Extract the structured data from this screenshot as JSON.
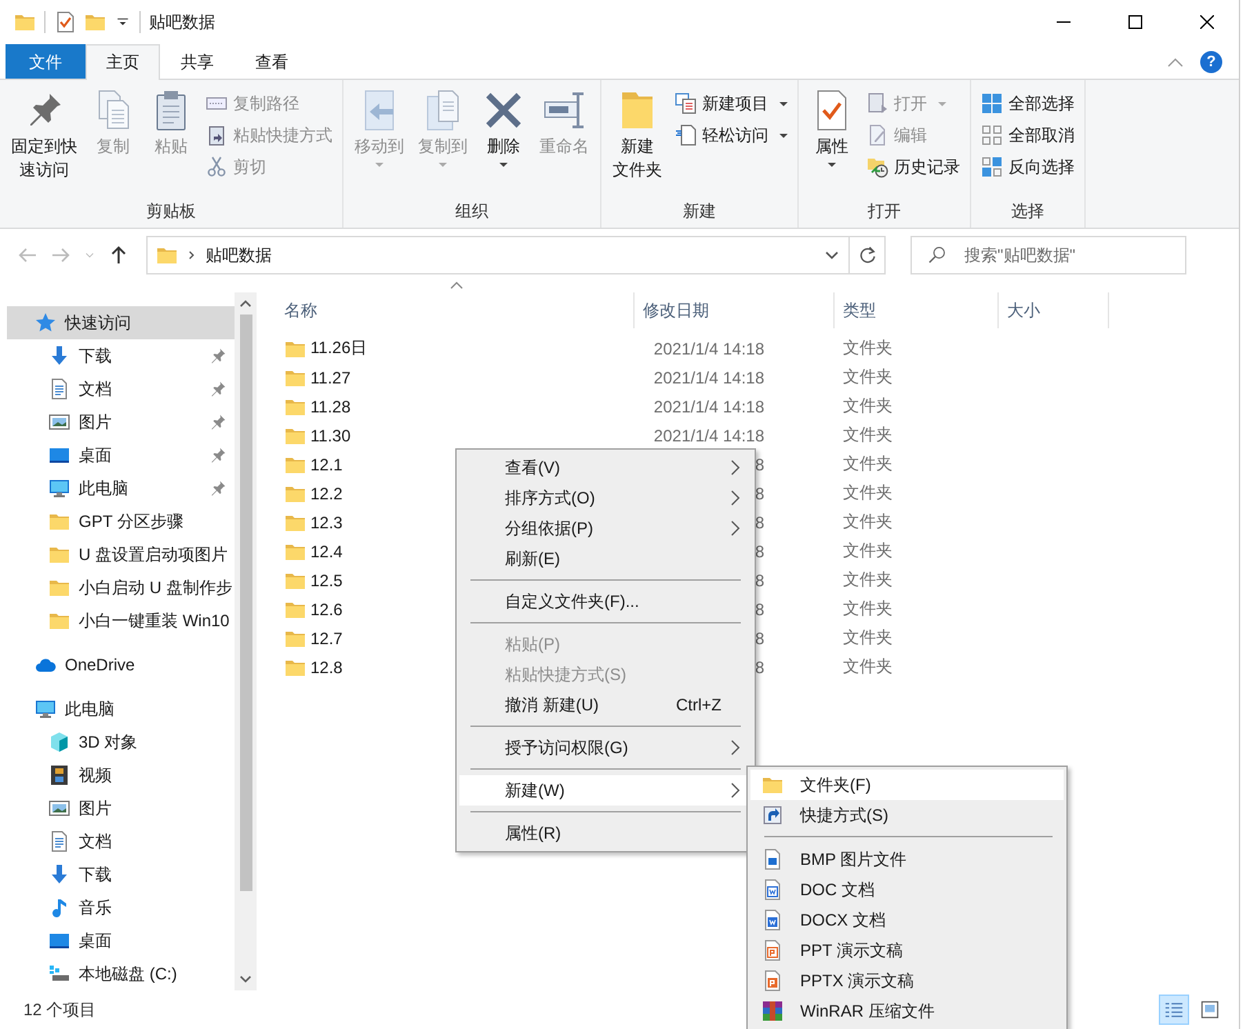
{
  "window": {
    "title": "贴吧数据"
  },
  "ribbon_tabs": [
    {
      "label": "文件",
      "kind": "file",
      "selected": false
    },
    {
      "label": "主页",
      "kind": "tab",
      "selected": true
    },
    {
      "label": "共享",
      "kind": "tab",
      "selected": false
    },
    {
      "label": "查看",
      "kind": "tab",
      "selected": false
    }
  ],
  "help_button": {
    "label": "?"
  },
  "ribbon_groups": [
    {
      "label": "剪贴板",
      "commands": [
        {
          "label": [
            "固定到快",
            "速访问"
          ],
          "kind": "large",
          "disabled": false,
          "dropdown": false
        },
        {
          "label": [
            "复制"
          ],
          "kind": "large",
          "disabled": true,
          "dropdown": false
        },
        {
          "label": [
            "粘贴"
          ],
          "kind": "large",
          "disabled": true,
          "dropdown": false
        },
        {
          "label": "复制路径",
          "kind": "small",
          "disabled": true,
          "dropdown": false
        },
        {
          "label": "粘贴快捷方式",
          "kind": "small",
          "disabled": true,
          "dropdown": false
        },
        {
          "label": "剪切",
          "kind": "small",
          "disabled": true,
          "dropdown": false
        }
      ]
    },
    {
      "label": "组织",
      "commands": [
        {
          "label": [
            "移动到"
          ],
          "kind": "large",
          "disabled": true,
          "dropdown": true
        },
        {
          "label": [
            "复制到"
          ],
          "kind": "large",
          "disabled": true,
          "dropdown": true
        },
        {
          "label": [
            "删除"
          ],
          "kind": "large",
          "disabled": false,
          "dropdown": true
        },
        {
          "label": [
            "重命名"
          ],
          "kind": "large",
          "disabled": true,
          "dropdown": false
        }
      ]
    },
    {
      "label": "新建",
      "commands": [
        {
          "label": [
            "新建",
            "文件夹"
          ],
          "kind": "large",
          "disabled": false,
          "dropdown": false
        },
        {
          "label": "新建项目",
          "kind": "small",
          "disabled": false,
          "dropdown": true
        },
        {
          "label": "轻松访问",
          "kind": "small",
          "disabled": false,
          "dropdown": true
        }
      ]
    },
    {
      "label": "打开",
      "commands": [
        {
          "label": [
            "属性"
          ],
          "kind": "large",
          "disabled": false,
          "dropdown": true
        },
        {
          "label": "打开",
          "kind": "small",
          "disabled": true,
          "dropdown": true
        },
        {
          "label": "编辑",
          "kind": "small",
          "disabled": true,
          "dropdown": false
        },
        {
          "label": "历史记录",
          "kind": "small",
          "disabled": false,
          "dropdown": false
        }
      ]
    },
    {
      "label": "选择",
      "commands": [
        {
          "label": "全部选择",
          "kind": "small",
          "disabled": false,
          "dropdown": false
        },
        {
          "label": "全部取消",
          "kind": "small",
          "disabled": false,
          "dropdown": false
        },
        {
          "label": "反向选择",
          "kind": "small",
          "disabled": false,
          "dropdown": false
        }
      ]
    }
  ],
  "navigation": [
    {
      "kind": "back",
      "disabled": true
    },
    {
      "kind": "forward",
      "disabled": true
    },
    {
      "kind": "recent",
      "disabled": true
    },
    {
      "kind": "up",
      "disabled": false
    }
  ],
  "address": {
    "path": [
      "贴吧数据"
    ]
  },
  "search": {
    "placeholder": "搜索\"贴吧数据\""
  },
  "sidebar": {
    "items": [
      {
        "label": "快速访问",
        "selected": true,
        "children": [
          {
            "label": "下载",
            "pinned": true,
            "selected": false
          },
          {
            "label": "文档",
            "pinned": true,
            "selected": false
          },
          {
            "label": "图片",
            "pinned": true,
            "selected": false
          },
          {
            "label": "桌面",
            "pinned": true,
            "selected": false
          },
          {
            "label": "此电脑",
            "pinned": true,
            "selected": false
          },
          {
            "label": "GPT 分区步骤",
            "pinned": false,
            "selected": false
          },
          {
            "label": "U 盘设置启动项图片",
            "pinned": false,
            "selected": false
          },
          {
            "label": "小白启动 U 盘制作步",
            "pinned": false,
            "selected": false
          },
          {
            "label": "小白一键重装 Win10",
            "pinned": false,
            "selected": false
          }
        ]
      },
      {
        "label": "OneDrive",
        "selected": false
      },
      {
        "label": "此电脑",
        "selected": false,
        "children": [
          {
            "label": "3D 对象",
            "pinned": false,
            "selected": false
          },
          {
            "label": "视频",
            "pinned": false,
            "selected": false
          },
          {
            "label": "图片",
            "pinned": false,
            "selected": false
          },
          {
            "label": "文档",
            "pinned": false,
            "selected": false
          },
          {
            "label": "下载",
            "pinned": false,
            "selected": false
          },
          {
            "label": "音乐",
            "pinned": false,
            "selected": false
          },
          {
            "label": "桌面",
            "pinned": false,
            "selected": false
          },
          {
            "label": "本地磁盘 (C:)",
            "pinned": false,
            "selected": false
          }
        ]
      }
    ]
  },
  "table": {
    "columns": [
      "名称",
      "修改日期",
      "类型",
      "大小"
    ],
    "rows": [
      {
        "name": "11.26日",
        "modified": "2021/1/4 14:18",
        "type": "文件夹"
      },
      {
        "name": "11.27",
        "modified": "2021/1/4 14:18",
        "type": "文件夹"
      },
      {
        "name": "11.28",
        "modified": "2021/1/4 14:18",
        "type": "文件夹"
      },
      {
        "name": "11.30",
        "modified": "2021/1/4 14:18",
        "type": "文件夹"
      },
      {
        "name": "12.1",
        "modified": "8",
        "type": "文件夹"
      },
      {
        "name": "12.2",
        "modified": "8",
        "type": "文件夹"
      },
      {
        "name": "12.3",
        "modified": "8",
        "type": "文件夹"
      },
      {
        "name": "12.4",
        "modified": "8",
        "type": "文件夹"
      },
      {
        "name": "12.5",
        "modified": "8",
        "type": "文件夹"
      },
      {
        "name": "12.6",
        "modified": "8",
        "type": "文件夹"
      },
      {
        "name": "12.7",
        "modified": "8",
        "type": "文件夹"
      },
      {
        "name": "12.8",
        "modified": "8",
        "type": "文件夹"
      }
    ]
  },
  "context_menu": {
    "items": [
      {
        "kind": "item",
        "label": "查看(V)",
        "submenu": true,
        "disabled": false,
        "selected": false
      },
      {
        "kind": "item",
        "label": "排序方式(O)",
        "submenu": true,
        "disabled": false,
        "selected": false
      },
      {
        "kind": "item",
        "label": "分组依据(P)",
        "submenu": true,
        "disabled": false,
        "selected": false
      },
      {
        "kind": "item",
        "label": "刷新(E)",
        "submenu": false,
        "disabled": false,
        "selected": false
      },
      {
        "kind": "separator"
      },
      {
        "kind": "item",
        "label": "自定义文件夹(F)...",
        "submenu": false,
        "disabled": false,
        "selected": false
      },
      {
        "kind": "separator"
      },
      {
        "kind": "item",
        "label": "粘贴(P)",
        "submenu": false,
        "disabled": true,
        "selected": false
      },
      {
        "kind": "item",
        "label": "粘贴快捷方式(S)",
        "submenu": false,
        "disabled": true,
        "selected": false
      },
      {
        "kind": "item",
        "label": "撤消 新建(U)",
        "shortcut": "Ctrl+Z",
        "submenu": false,
        "disabled": false,
        "selected": false
      },
      {
        "kind": "separator"
      },
      {
        "kind": "item",
        "label": "授予访问权限(G)",
        "submenu": true,
        "disabled": false,
        "selected": false
      },
      {
        "kind": "separator"
      },
      {
        "kind": "item",
        "label": "新建(W)",
        "submenu": true,
        "disabled": false,
        "selected": true
      },
      {
        "kind": "separator"
      },
      {
        "kind": "item",
        "label": "属性(R)",
        "submenu": false,
        "disabled": false,
        "selected": false
      }
    ]
  },
  "new_submenu": {
    "items": [
      {
        "kind": "item",
        "label": "文件夹(F)",
        "selected": true
      },
      {
        "kind": "item",
        "label": "快捷方式(S)",
        "selected": false
      },
      {
        "kind": "separator"
      },
      {
        "kind": "item",
        "label": "BMP 图片文件",
        "selected": false
      },
      {
        "kind": "item",
        "label": "DOC 文档",
        "selected": false
      },
      {
        "kind": "item",
        "label": "DOCX 文档",
        "selected": false
      },
      {
        "kind": "item",
        "label": "PPT 演示文稿",
        "selected": false
      },
      {
        "kind": "item",
        "label": "PPTX 演示文稿",
        "selected": false
      },
      {
        "kind": "item",
        "label": "WinRAR 压缩文件",
        "selected": false
      }
    ]
  },
  "status_bar": {
    "item_count": "12 个项目",
    "view_buttons": [
      {
        "selected": true
      },
      {
        "selected": false
      }
    ]
  }
}
